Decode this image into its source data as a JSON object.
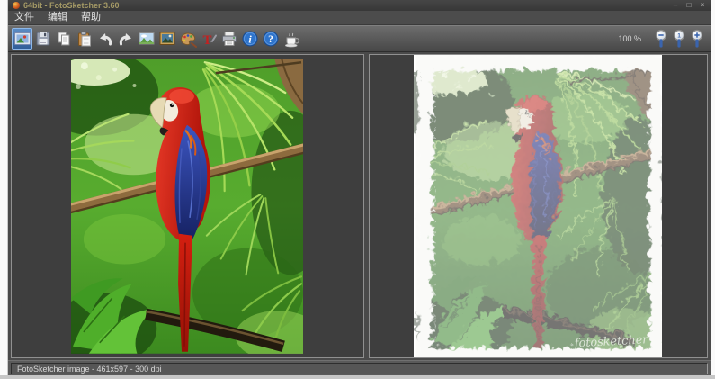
{
  "window": {
    "title": "64bit - FotoSketcher 3.60",
    "controls": [
      {
        "name": "minimize",
        "glyph": "–"
      },
      {
        "name": "maximize",
        "glyph": "□"
      },
      {
        "name": "close",
        "glyph": "×"
      }
    ]
  },
  "menu": {
    "items": [
      {
        "id": "file",
        "label": "文件"
      },
      {
        "id": "edit",
        "label": "编辑"
      },
      {
        "id": "help",
        "label": "帮助"
      }
    ]
  },
  "toolbar": {
    "buttons": [
      {
        "icon": "open-image",
        "selected": true
      },
      {
        "icon": "save-image",
        "selected": false
      },
      {
        "icon": "copy",
        "selected": false
      },
      {
        "icon": "paste",
        "selected": false
      },
      {
        "icon": "undo",
        "selected": false
      },
      {
        "icon": "redo",
        "selected": false
      },
      {
        "icon": "view-original-image",
        "selected": false
      },
      {
        "icon": "view-framed-image",
        "selected": false
      },
      {
        "icon": "drawing-parameters-palette",
        "selected": false
      },
      {
        "icon": "add-text",
        "selected": false
      },
      {
        "icon": "print",
        "selected": false
      },
      {
        "icon": "about-info",
        "selected": false
      },
      {
        "icon": "help",
        "selected": false
      },
      {
        "icon": "donate-coffee",
        "selected": false
      }
    ],
    "zoom_level": "100 %",
    "zoom_buttons": [
      "zoom-out",
      "zoom-100",
      "zoom-in"
    ]
  },
  "panels": {
    "left": {
      "name": "original-image",
      "content": "photo of scarlet macaw perched on branch in green jungle"
    },
    "right": {
      "name": "painted-image",
      "content": "painted version of the macaw photo on white canvas",
      "signature": "fotosketcher"
    }
  },
  "status": {
    "text": "FotoSketcher image - 461x597 - 300 dpi"
  },
  "colors": {
    "titlebar": "#3c3c3c",
    "menubar": "#4c4c4c",
    "toolbar_top": "#6d6d6d",
    "toolbar_bottom": "#474747",
    "panel_bg": "#3e3e3e",
    "selected_button": "#2e5b96",
    "title_text": "#a59a66",
    "status_text": "#d6d6d6"
  }
}
